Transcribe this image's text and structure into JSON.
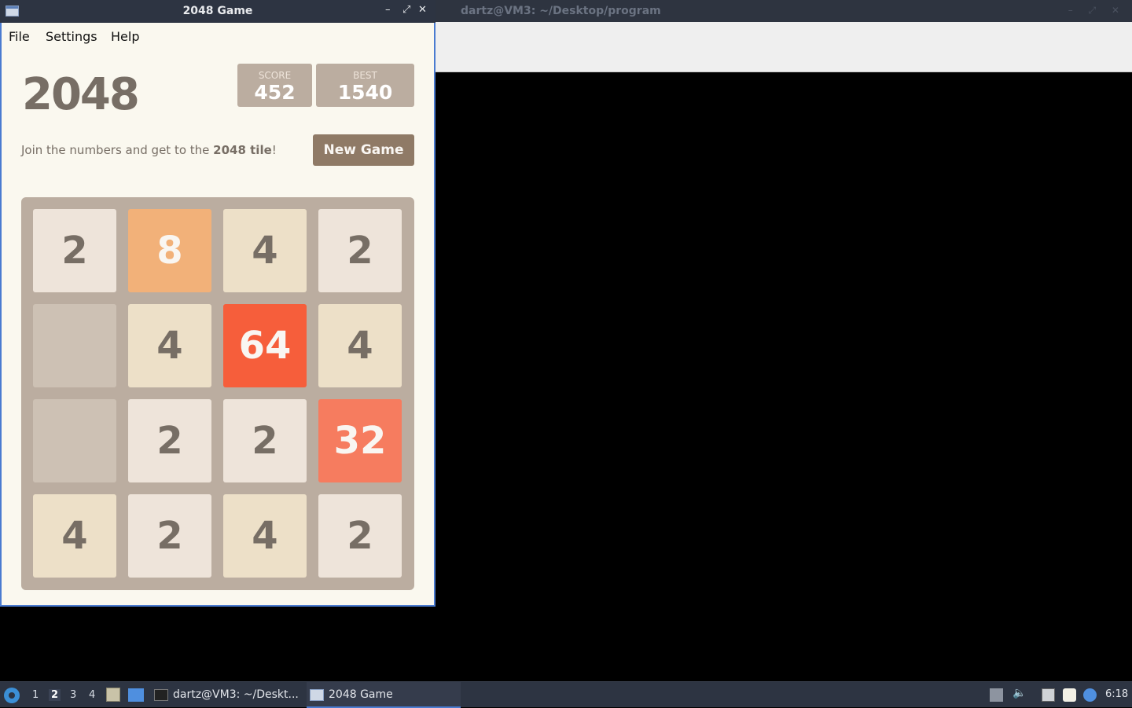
{
  "terminal": {
    "title": "dartz@VM3: ~/Desktop/program"
  },
  "game_window": {
    "title": "2048 Game",
    "controls": {
      "minimize": "–",
      "maximize": "⤢",
      "close": "✕"
    },
    "menu": {
      "file": "File",
      "settings": "Settings",
      "help": "Help"
    },
    "heading": "2048",
    "score": {
      "label": "SCORE",
      "value": "452"
    },
    "best": {
      "label": "BEST",
      "value": "1540"
    },
    "intro_prefix": "Join the numbers and get to the ",
    "intro_bold": "2048 tile",
    "intro_suffix": "!",
    "new_game_label": "New Game",
    "board": [
      [
        "2",
        "8",
        "4",
        "2"
      ],
      [
        "",
        "4",
        "64",
        "4"
      ],
      [
        "",
        "2",
        "2",
        "32"
      ],
      [
        "4",
        "2",
        "4",
        "2"
      ]
    ]
  },
  "tile_colors": {
    "empty": {
      "bg": "#cdc1b4",
      "fg": "#776e65"
    },
    "2": {
      "bg": "#eee4da",
      "fg": "#776e65"
    },
    "4": {
      "bg": "#ede0c8",
      "fg": "#776e65"
    },
    "8": {
      "bg": "#f2b179",
      "fg": "#f9f6f2"
    },
    "32": {
      "bg": "#f67c5f",
      "fg": "#f9f6f2"
    },
    "64": {
      "bg": "#f65e3b",
      "fg": "#f9f6f2"
    }
  },
  "taskbar": {
    "workspaces": [
      "1",
      "2",
      "3",
      "4"
    ],
    "active_workspace": "2",
    "tasks": {
      "terminal": "dartz@VM3: ~/Deskt...",
      "game": "2048 Game"
    },
    "volume_icon": "🔈",
    "clock": "6:18"
  }
}
